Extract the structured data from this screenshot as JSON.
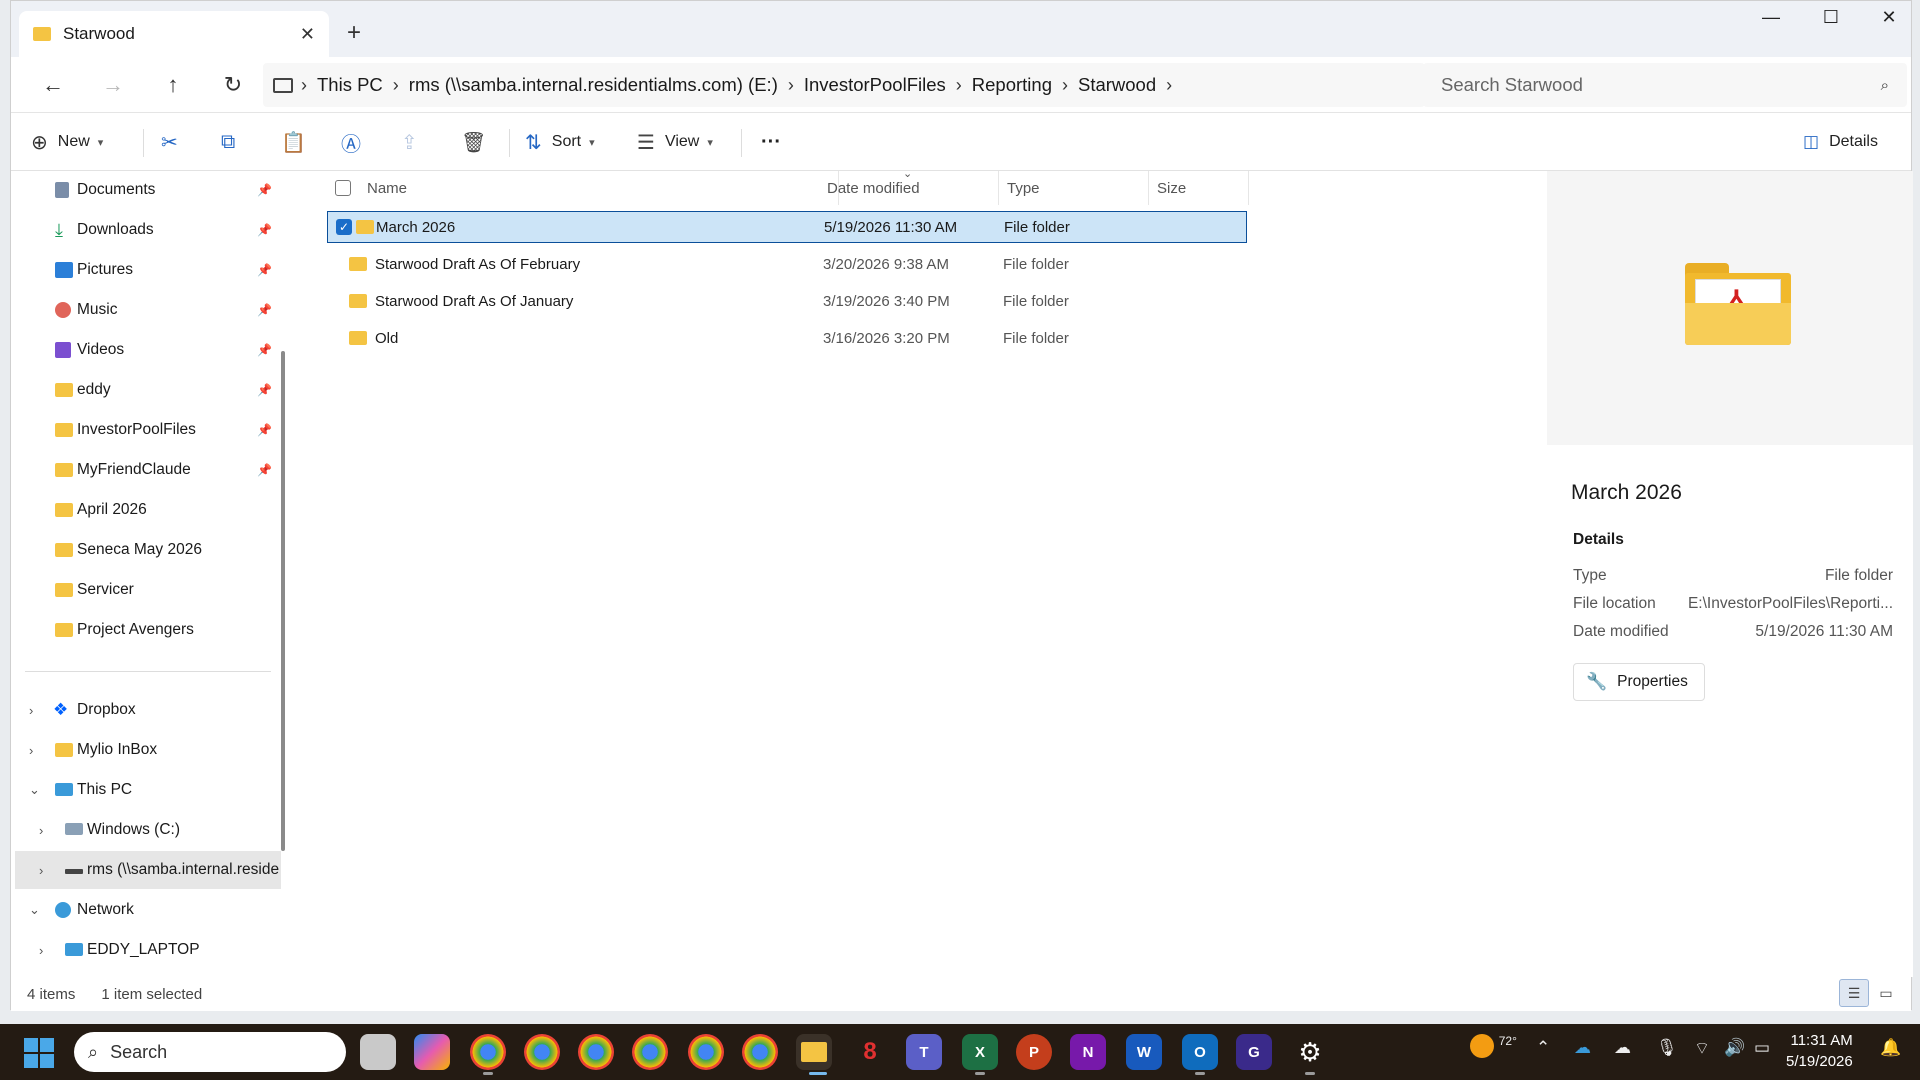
{
  "window": {
    "tab_title": "Starwood",
    "new_tab": "+",
    "close_tab": "✕",
    "minimize": "—",
    "maximize": "☐",
    "close": "✕"
  },
  "nav": {
    "back": "←",
    "forward": "→",
    "up": "↑",
    "refresh": "↻"
  },
  "breadcrumb": [
    "This PC",
    "rms (\\\\samba.internal.residentialms.com) (E:)",
    "InvestorPoolFiles",
    "Reporting",
    "Starwood"
  ],
  "search": {
    "placeholder": "Search Starwood"
  },
  "toolbar": {
    "new_label": "New",
    "sort_label": "Sort",
    "view_label": "View",
    "more_label": "···",
    "details_label": "Details"
  },
  "sidebar": {
    "pinned": [
      {
        "label": "Documents",
        "icon": "documents-icon",
        "color": "#7a8da8"
      },
      {
        "label": "Downloads",
        "icon": "downloads-icon",
        "color": "#1a9a5a"
      },
      {
        "label": "Pictures",
        "icon": "pictures-icon",
        "color": "#2b7fd8"
      },
      {
        "label": "Music",
        "icon": "music-icon",
        "color": "#e0655a"
      },
      {
        "label": "Videos",
        "icon": "videos-icon",
        "color": "#7b4fd0"
      },
      {
        "label": "eddy",
        "icon": "folder-icon",
        "color": "#f4c443"
      },
      {
        "label": "InvestorPoolFiles",
        "icon": "folder-icon",
        "color": "#f4c443"
      },
      {
        "label": "MyFriendClaude",
        "icon": "folder-icon",
        "color": "#f4c443"
      }
    ],
    "recent": [
      {
        "label": "April 2026"
      },
      {
        "label": "Seneca May 2026"
      },
      {
        "label": "Servicer"
      },
      {
        "label": "Project Avengers"
      }
    ],
    "tree": [
      {
        "label": "Dropbox",
        "expanded": false,
        "indent": 0
      },
      {
        "label": "Mylio InBox",
        "expanded": false,
        "indent": 0
      },
      {
        "label": "This PC",
        "expanded": true,
        "indent": 0
      },
      {
        "label": "Windows (C:)",
        "expanded": false,
        "indent": 1
      },
      {
        "label": "rms (\\\\samba.internal.reside",
        "expanded": false,
        "indent": 1,
        "selected": true
      },
      {
        "label": "Network",
        "expanded": true,
        "indent": 0
      },
      {
        "label": "EDDY_LAPTOP",
        "expanded": false,
        "indent": 1
      }
    ]
  },
  "columns": {
    "name": "Name",
    "date": "Date modified",
    "type": "Type",
    "size": "Size"
  },
  "files": [
    {
      "name": "March 2026",
      "date": "5/19/2026 11:30 AM",
      "type": "File folder",
      "size": "",
      "selected": true
    },
    {
      "name": "Starwood Draft As Of February",
      "date": "3/20/2026 9:38 AM",
      "type": "File folder",
      "size": ""
    },
    {
      "name": "Starwood Draft As Of January",
      "date": "3/19/2026 3:40 PM",
      "type": "File folder",
      "size": ""
    },
    {
      "name": "Old",
      "date": "3/16/2026 3:20 PM",
      "type": "File folder",
      "size": ""
    }
  ],
  "details": {
    "title": "March 2026",
    "heading": "Details",
    "type_label": "Type",
    "type_value": "File folder",
    "location_label": "File location",
    "location_value": "E:\\InvestorPoolFiles\\Reporti...",
    "date_label": "Date modified",
    "date_value": "5/19/2026 11:30 AM",
    "properties_label": "Properties"
  },
  "status": {
    "count": "4 items",
    "selected": "1 item selected"
  },
  "taskbar": {
    "search_label": "Search",
    "weather": "72°",
    "time": "11:31 AM",
    "date": "5/19/2026"
  },
  "colors": {
    "accent": "#1a6dc9",
    "selection": "#cce4f7",
    "folder": "#f4c443",
    "taskbar": "#241b13"
  }
}
